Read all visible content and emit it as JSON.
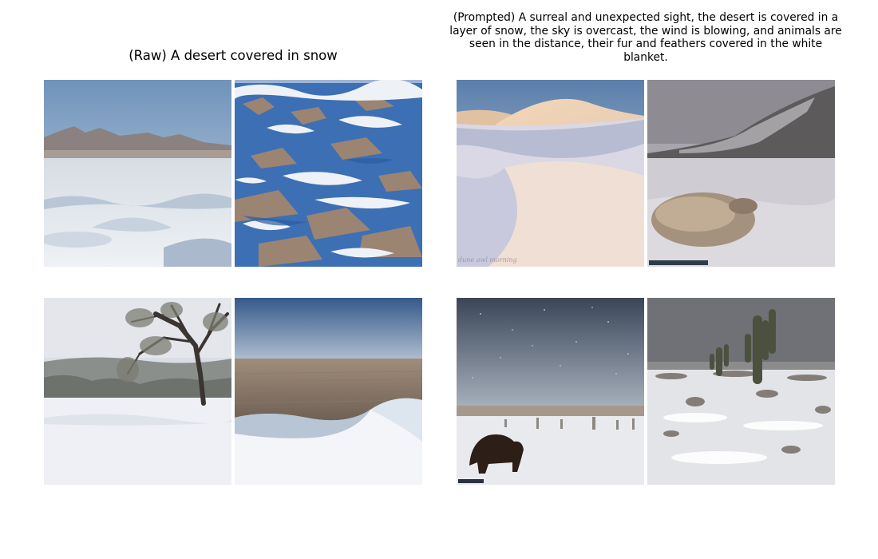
{
  "panels": [
    {
      "title": "(Raw) A desert covered in snow"
    },
    {
      "title": "(Prompted) A surreal and unexpected sight, the desert is covered in a layer of snow, the sky is overcast, the wind is blowing, and animals are seen in the distance, their fur and feathers covered in the white blanket."
    }
  ],
  "images": {
    "raw_1": {
      "subject": "snowy desert plain with distant mountains"
    },
    "raw_2": {
      "subject": "snow patches over rocky desert ground, blue sky"
    },
    "raw_3": {
      "subject": "snow-covered tree over white desert ground"
    },
    "raw_4": {
      "subject": "snow drift in front of flat sandy plain"
    },
    "prompted_1": {
      "subject": "snow-covered dune at sunset",
      "watermark": "dune awl morning"
    },
    "prompted_2": {
      "subject": "furry animal lying in snow under a dark hillside"
    },
    "prompted_3": {
      "subject": "dark furry animal standing in snowy desert at night"
    },
    "prompted_4": {
      "subject": "two cacti in a snow-dusted desert under grey sky"
    }
  }
}
